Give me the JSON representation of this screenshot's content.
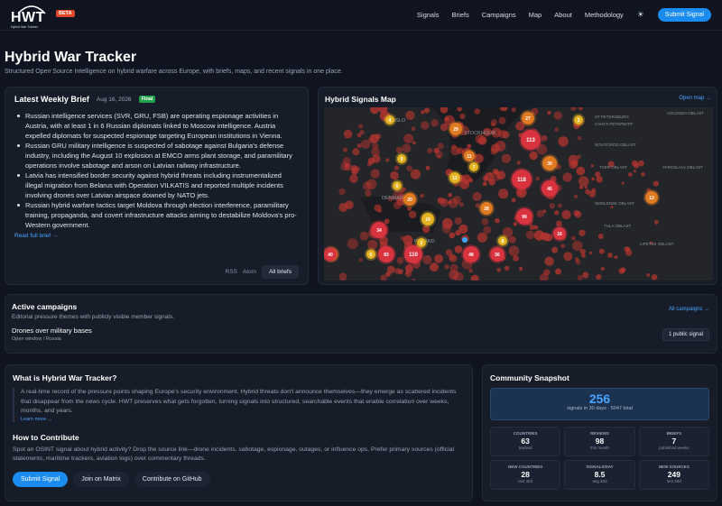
{
  "nav": {
    "logo_text": "HWT",
    "logo_sub": "Hybrid War Tracker",
    "beta": "BETA",
    "links": [
      "Signals",
      "Briefs",
      "Campaigns",
      "Map",
      "About",
      "Methodology"
    ],
    "submit": "Submit Signal"
  },
  "page": {
    "title": "Hybrid War Tracker",
    "tagline": "Structured Open Source Intelligence on hybrid warfare across Europe, with briefs, maps, and recent signals in one place."
  },
  "brief": {
    "title": "Latest Weekly Brief",
    "date": "Aug 16, 2026",
    "status": "Final",
    "items": [
      "Russian intelligence services (SVR, GRU, FSB) are operating espionage activities in Austria, with at least 1 in 6 Russian diplomats linked to Moscow intelligence. Austria expelled diplomats for suspected espionage targeting European institutions in Vienna.",
      "Russian GRU military intelligence is suspected of sabotage against Bulgaria's defense industry, including the August 10 explosion at EMCO arms plant storage, and paramilitary operations involve sabotage and arson on Latvian railway infrastructure.",
      "Latvia has intensified border security against hybrid threats including instrumentalized illegal migration from Belarus with Operation VILKATIS and reported multiple incidents involving drones over Latvian airspace downed by NATO jets.",
      "Russian hybrid warfare tactics target Moldova through election interference, paramilitary training, propaganda, and covert infrastructure attacks aiming to destabilize Moldova's pro-Western government."
    ],
    "read_full": "Read full brief →",
    "rss": "RSS",
    "atom": "Atom",
    "all_briefs": "All briefs"
  },
  "map": {
    "title": "Hybrid Signals Map",
    "open": "Open map →",
    "labels": [
      "OSLO",
      "STOCKHOLM",
      "ST PETERSBURG",
      "САНКТ-ПЕТЕРБУРГ",
      "VOLOGDA OBLAST",
      "NOVGOROD OBLAST",
      "TVER OBLAST",
      "YAROSLAVL OBLAST",
      "SMOLENSK OBLAST",
      "TULA OBLAST",
      "LIPETSK OBLAST",
      "DENMARK",
      "POLAND"
    ],
    "clusters": [
      {
        "n": "29"
      },
      {
        "n": "27"
      },
      {
        "n": "113"
      },
      {
        "n": "30"
      },
      {
        "n": "11"
      },
      {
        "n": "118"
      },
      {
        "n": "45"
      },
      {
        "n": "20"
      },
      {
        "n": "28"
      },
      {
        "n": "19"
      },
      {
        "n": "99"
      },
      {
        "n": "16"
      },
      {
        "n": "34"
      },
      {
        "n": "110"
      },
      {
        "n": "48"
      },
      {
        "n": "56"
      },
      {
        "n": "83"
      },
      {
        "n": "14"
      },
      {
        "n": "13"
      },
      {
        "n": "4"
      },
      {
        "n": "9"
      },
      {
        "n": "6"
      },
      {
        "n": "3"
      },
      {
        "n": "8"
      },
      {
        "n": "5"
      },
      {
        "n": "2"
      },
      {
        "n": "12"
      },
      {
        "n": "7"
      },
      {
        "n": "40"
      }
    ]
  },
  "campaigns": {
    "title": "Active campaigns",
    "subtitle": "Editorial pressure themes with publicly visible member signals.",
    "all": "All campaigns →",
    "item": "Drones over military bases",
    "meta": "Open window / Russia",
    "badge": "1 public signal"
  },
  "about": {
    "title": "What is Hybrid War Tracker?",
    "text": "A real-time record of the pressure points shaping Europe's security environment. Hybrid threats don't announce themselves—they emerge as scattered incidents that disappear from the news cycle. HWT preserves what gets forgotten, turning signals into structured, searchable events that enable correlation over weeks, months, and years.",
    "learn": "Learn more →",
    "contrib_title": "How to Contribute",
    "contrib_text": "Spot an OSINT signal about hybrid activity? Drop the source link—drone incidents, sabotage, espionage, outages, or influence ops. Prefer primary sources (official statements, maritime trackers, aviation logs) over commentary threads.",
    "btn_submit": "Submit Signal",
    "btn_matrix": "Join on Matrix",
    "btn_github": "Contribute on GitHub"
  },
  "snapshot": {
    "title": "Community Snapshot",
    "big": "256",
    "big_sub": "signals in 30 days · 5047 total",
    "cells": [
      {
        "label": "Countries",
        "value": "63",
        "sub": "tracked"
      },
      {
        "label": "Reviews",
        "value": "98",
        "sub": "this month"
      },
      {
        "label": "Briefs",
        "value": "7",
        "sub": "published weeks"
      },
      {
        "label": "New countries",
        "value": "28",
        "sub": "last 30d"
      },
      {
        "label": "Signals/day",
        "value": "8.5",
        "sub": "avg 30d"
      },
      {
        "label": "New sources",
        "value": "249",
        "sub": "last 30d"
      }
    ]
  },
  "colors": {
    "accent": "#1a8cf0",
    "final": "#22a34a",
    "beta": "#e0452b",
    "cluster_red": "#d8333f",
    "cluster_orange": "#e07b22",
    "cluster_yellow": "#e6b422"
  }
}
